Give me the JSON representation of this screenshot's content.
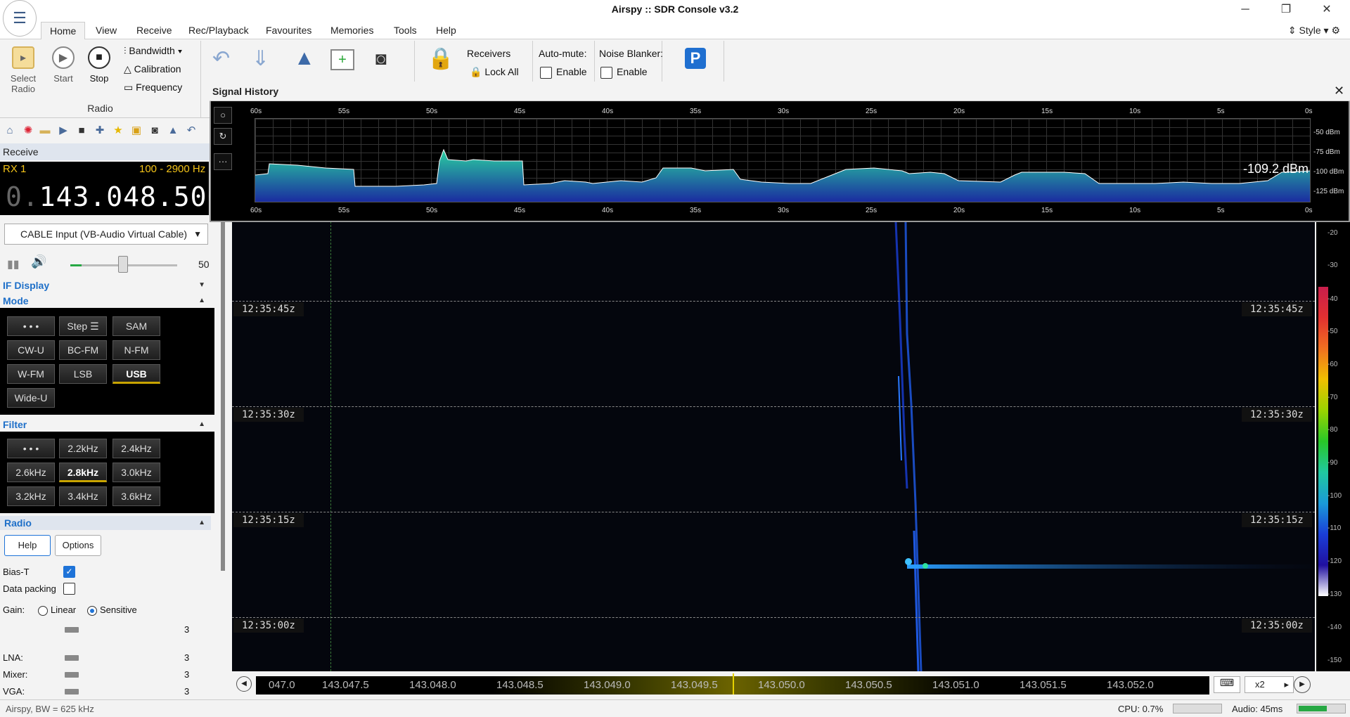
{
  "window": {
    "title": "Airspy :: SDR Console v3.2"
  },
  "menu": {
    "tabs": [
      "Home",
      "View",
      "Receive",
      "Rec/Playback",
      "Favourites",
      "Memories",
      "Tools",
      "Help"
    ],
    "style": "Style"
  },
  "ribbon": {
    "select_radio": "Select Radio",
    "start": "Start",
    "stop": "Stop",
    "bandwidth": "Bandwidth",
    "calibration": "Calibration",
    "frequency": "Frequency",
    "group_radio": "Radio",
    "receivers": "Receivers",
    "lock_all": "Lock All",
    "auto_mute": "Auto-mute:",
    "enable1": "Enable",
    "noise_blanker": "Noise Blanker:",
    "enable2": "Enable"
  },
  "receive": {
    "header": "Receive",
    "rx_label": "RX 1",
    "bw": "100 - 2900 Hz",
    "freq_dim": "0.",
    "freq": "143.048.500",
    "input": "CABLE Input (VB-Audio Virtual Cable)",
    "volume": "50",
    "volume_level": 0.5
  },
  "if_display": "IF Display",
  "mode": {
    "header": "Mode",
    "buttons": [
      "• • •",
      "Step ☰",
      "SAM",
      "CW-U",
      "BC-FM",
      "N-FM",
      "W-FM",
      "LSB",
      "USB",
      "Wide-U"
    ],
    "selected": "USB"
  },
  "filter": {
    "header": "Filter",
    "buttons": [
      "• • •",
      "2.2kHz",
      "2.4kHz",
      "2.6kHz",
      "2.8kHz",
      "3.0kHz",
      "3.2kHz",
      "3.4kHz",
      "3.6kHz"
    ],
    "selected": "2.8kHz"
  },
  "radio": {
    "header": "Radio",
    "help": "Help",
    "options": "Options",
    "bias_t": "Bias-T",
    "data_packing": "Data packing",
    "gain": "Gain:",
    "linear": "Linear",
    "sensitive": "Sensitive",
    "gain_val": "3",
    "lna": "LNA:",
    "lna_val": "3",
    "mixer": "Mixer:",
    "mixer_val": "3",
    "vga": "VGA:",
    "vga_val": "3"
  },
  "waterfall": {
    "times": [
      "12:35:45z",
      "12:35:30z",
      "12:35:15z",
      "12:35:00z"
    ]
  },
  "scale": [
    "-20",
    "-30",
    "-40",
    "-50",
    "-60",
    "-70",
    "-80",
    "-90",
    "-100",
    "-110",
    "-120",
    "-130",
    "-140",
    "-150"
  ],
  "freqbar": {
    "labels": [
      "047.0",
      "143.047.5",
      "143.048.0",
      "143.048.5",
      "143.049.0",
      "143.049.5",
      "143.050.0",
      "143.050.5",
      "143.051.0",
      "143.051.5",
      "143.052.0"
    ],
    "zoom": "x2"
  },
  "signal_history": {
    "title": "Signal History",
    "ticks": [
      "60s",
      "55s",
      "50s",
      "45s",
      "40s",
      "35s",
      "30s",
      "25s",
      "20s",
      "15s",
      "10s",
      "5s",
      "0s"
    ],
    "db_labels": [
      "-50 dBm",
      "-75 dBm",
      "-100 dBm",
      "-125 dBm"
    ],
    "readout": "-109.2 dBm"
  },
  "status": {
    "left": "Airspy, BW = 625 kHz",
    "cpu": "CPU: 0.7%",
    "audio": "Audio: 45ms"
  }
}
